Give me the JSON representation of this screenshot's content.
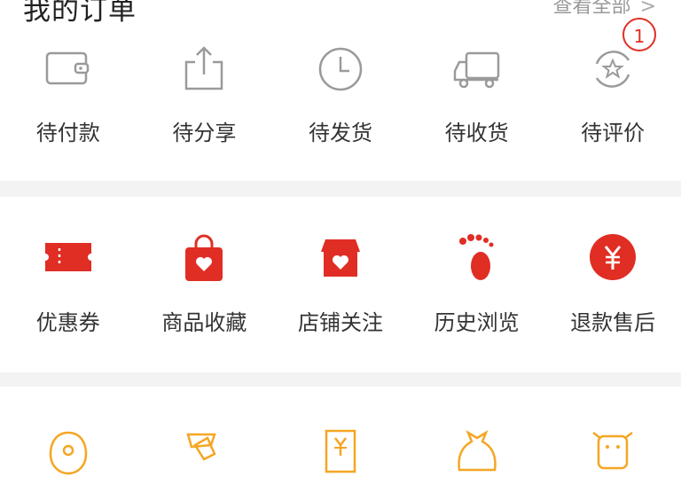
{
  "header": {
    "title": "我的订单",
    "view_all": "查看全部",
    "chevron": "chevron-right-icon"
  },
  "order_status": [
    {
      "label": "待付款",
      "icon": "wallet-icon"
    },
    {
      "label": "待分享",
      "icon": "share-icon"
    },
    {
      "label": "待发货",
      "icon": "clock-icon"
    },
    {
      "label": "待收货",
      "icon": "truck-icon"
    },
    {
      "label": "待评价",
      "icon": "review-star-icon",
      "badge": "1"
    }
  ],
  "services": [
    {
      "label": "优惠券",
      "icon": "coupon-icon"
    },
    {
      "label": "商品收藏",
      "icon": "favorite-bag-icon"
    },
    {
      "label": "店铺关注",
      "icon": "shop-follow-icon"
    },
    {
      "label": "历史浏览",
      "icon": "footprint-icon"
    },
    {
      "label": "退款售后",
      "icon": "refund-yen-icon"
    }
  ],
  "extras": [
    {
      "icon": "fruit-icon"
    },
    {
      "icon": "speaker-icon"
    },
    {
      "icon": "receipt-yen-icon"
    },
    {
      "icon": "bag-icon"
    },
    {
      "icon": "cow-icon"
    }
  ],
  "colors": {
    "accent": "#e02e24",
    "gray_icon": "#9a9a9a",
    "orange_icon": "#f5a623",
    "divider": "#f3f3f3"
  }
}
